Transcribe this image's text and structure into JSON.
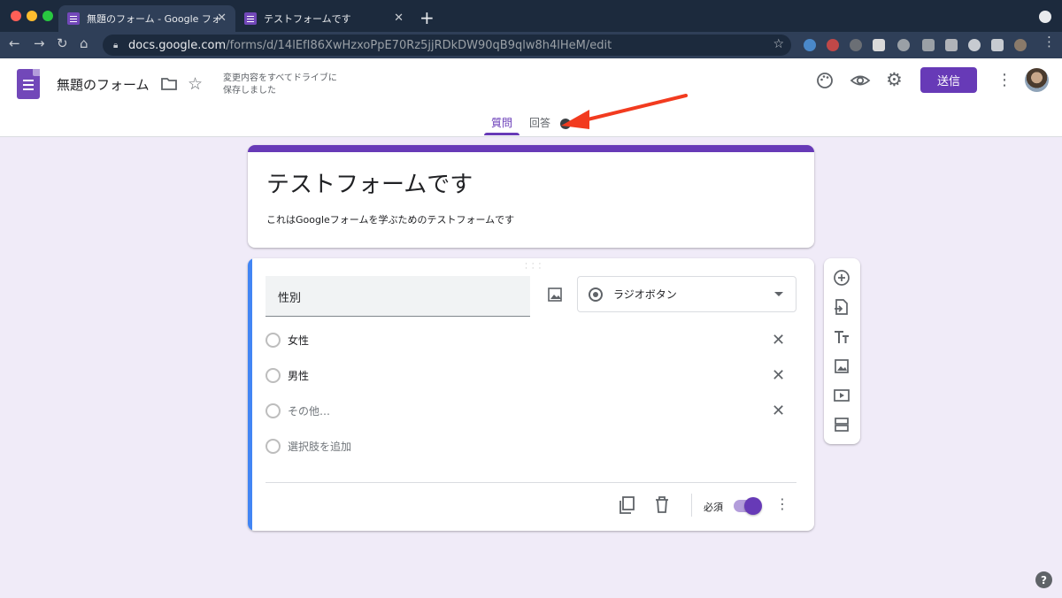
{
  "browser": {
    "tabs": [
      {
        "title": "無題のフォーム - Google フォーム"
      },
      {
        "title": "テストフォームです"
      }
    ],
    "url": {
      "host": "docs.google.com",
      "path": "/forms/d/14lEfI86XwHzxoPpE70Rz5jjRDkDW90qB9qlw8h4lHeM/edit"
    }
  },
  "header": {
    "doc_title": "無題のフォーム",
    "save_status_line1": "変更内容をすべてドライブに",
    "save_status_line2": "保存しました",
    "send_label": "送信"
  },
  "tabs": {
    "questions": "質問",
    "responses": "回答"
  },
  "form": {
    "title": "テストフォームです",
    "description": "これはGoogleフォームを学ぶためのテストフォームです"
  },
  "question": {
    "text": "性別",
    "type_label": "ラジオボタン",
    "options": [
      {
        "label": "女性"
      },
      {
        "label": "男性"
      },
      {
        "label": "その他…"
      }
    ],
    "add_option": "選択肢を追加",
    "required_label": "必須",
    "required": true
  },
  "colors": {
    "accent": "#673ab7",
    "background": "#f0ebf8",
    "question_accent": "#4285f4",
    "annotation_arrow": "#f23b1f"
  }
}
